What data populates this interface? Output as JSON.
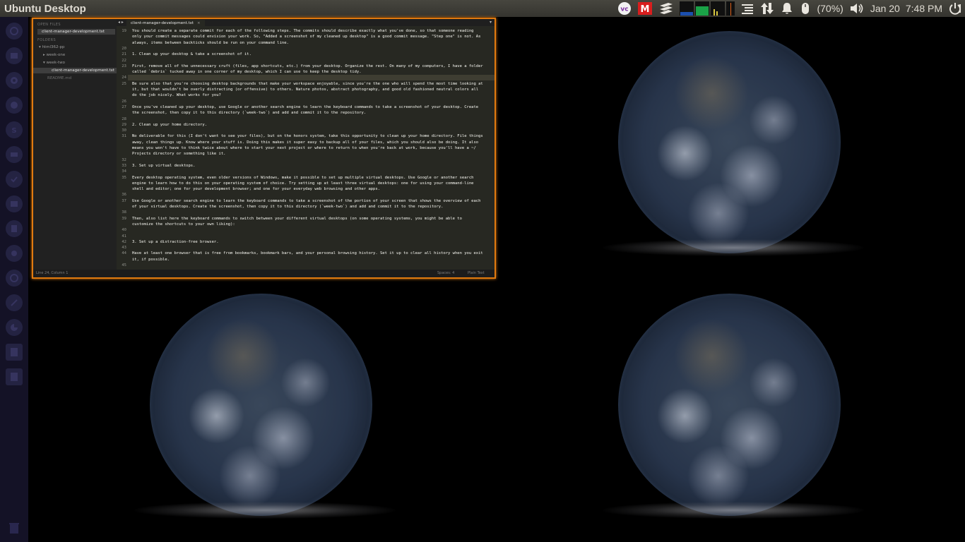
{
  "panel": {
    "title": "Ubuntu Desktop",
    "battery_text": "(70%)",
    "date": "Jan 20",
    "time": "7:48 PM"
  },
  "icons": {
    "indicators": [
      "vc-icon",
      "m-indicator-icon",
      "layers-icon",
      "system-monitor-icon",
      "menu-list-icon",
      "network-arrows-icon",
      "notification-bell-icon",
      "mouse-battery-icon",
      "volume-icon",
      "power-icon"
    ],
    "launcher": [
      "dash-icon",
      "files-icon",
      "chrome-icon",
      "firefox-icon",
      "sublime-icon",
      "skype-icon",
      "text-editor-icon",
      "terminal-icon",
      "app-icon",
      "app-icon",
      "settings-icon",
      "disk-icon",
      "disk-icon",
      "tools-icon",
      "usage-icon",
      "drive-icon",
      "drive-icon",
      "trash-icon"
    ]
  },
  "colors": {
    "window_border": "#e07a10",
    "editor_bg": "#272822",
    "launcher_bg": "#141226"
  },
  "editor": {
    "tab_label": "client-manager-development.txt",
    "sidebar": {
      "open_files_header": "OPEN FILES",
      "open_file": "client-manager-development.txt",
      "folders_header": "FOLDERS",
      "folder_root": "html362-pp",
      "folder_week_one": "week-one",
      "folder_week_two": "week-two",
      "file_selected": "client-manager-development.txt",
      "file_readme": "README.md"
    },
    "status": {
      "position": "Line 24, Column 1",
      "spaces": "Spaces: 4",
      "syntax": "Plain Text"
    },
    "lines": [
      {
        "n": "19",
        "t": "You should create a separate commit for each of the following steps. The commits should describe exactly what you've done, so that someone reading"
      },
      {
        "n": "",
        "t": "only your commit messages could envision your work. So, \"Added a screenshot of my cleaned up desktop\" is a good commit message. \"Step one\" is not. As"
      },
      {
        "n": "",
        "t": "always, items between backticks should be run on your command line."
      },
      {
        "n": "20",
        "t": ""
      },
      {
        "n": "21",
        "t": "1. Clean up your desktop & take a screenshot of it."
      },
      {
        "n": "22",
        "t": ""
      },
      {
        "n": "23",
        "t": "First, remove all of the unnecessary cruft (files, app shortcuts, etc.) from your desktop. Organize the rest. On many of my computers, I have a folder"
      },
      {
        "n": "",
        "t": "called `debris` tucked away in one corner of my desktop, which I can use to keep the desktop tidy."
      },
      {
        "n": "24",
        "t": ""
      },
      {
        "n": "25",
        "t": "Be sure also that you're choosing desktop backgrounds that make your workspace enjoyable, since you're the one who will spend the most time looking at"
      },
      {
        "n": "",
        "t": "it, but that wouldn't be overly distracting (or offensive) to others. Nature photos, abstract photography, and good old fashioned neutral colors all"
      },
      {
        "n": "",
        "t": "do the job nicely. What works for you?"
      },
      {
        "n": "26",
        "t": ""
      },
      {
        "n": "27",
        "t": "Once you've cleaned up your desktop, use Google or another search engine to learn the keyboard commands to take a screenshot of your desktop. Create"
      },
      {
        "n": "",
        "t": "the screenshot, then copy it to this directory (`week-two`) and add and commit it to the repository."
      },
      {
        "n": "28",
        "t": ""
      },
      {
        "n": "29",
        "t": "2. Clean up your home directory."
      },
      {
        "n": "30",
        "t": ""
      },
      {
        "n": "31",
        "t": "No deliverable for this (I don't want to see your files), but on the honors system, take this opportunity to clean up your home directory. File things"
      },
      {
        "n": "",
        "t": "away, clean things up. Know where your stuff is. Doing this makes it super easy to backup all of your files, which you should also be doing. It also"
      },
      {
        "n": "",
        "t": "means you won't have to think twice about where to start your next project or where to return to when you're back at work, because you'll have a ~/"
      },
      {
        "n": "",
        "t": "Projects directory or something like it."
      },
      {
        "n": "32",
        "t": ""
      },
      {
        "n": "33",
        "t": "3. Set up virtual desktops."
      },
      {
        "n": "34",
        "t": ""
      },
      {
        "n": "35",
        "t": "Every desktop operating system, even older versions of Windows, make it possible to set up multiple virtual desktops. Use Google or another search"
      },
      {
        "n": "",
        "t": "engine to learn how to do this on your operating system of choice. Try setting up at least three virtual desktops: one for using your command-line"
      },
      {
        "n": "",
        "t": "shell and editor; one for your development browser; and one for your everyday web browsing and other apps."
      },
      {
        "n": "36",
        "t": ""
      },
      {
        "n": "37",
        "t": "Use Google or another search engine to learn the keyboard commands to take a screenshot of the portion of your screen that shows the overview of each"
      },
      {
        "n": "",
        "t": "of your virtual desktops. Create the screenshot, then copy it to this directory (`week-two`) and add and commit it to the repository."
      },
      {
        "n": "38",
        "t": ""
      },
      {
        "n": "39",
        "t": "Then, also list here the keyboard commands to switch between your different virtual desktops (on some operating systems, you might be able to"
      },
      {
        "n": "",
        "t": "customize the shortcuts to your own liking):"
      },
      {
        "n": "40",
        "t": ""
      },
      {
        "n": "41",
        "t": ""
      },
      {
        "n": "42",
        "t": "3. Set up a distraction-free browser."
      },
      {
        "n": "43",
        "t": ""
      },
      {
        "n": "44",
        "t": "Have at least one browser that is free from bookmarks, bookmark bars, and your personal browsing history. Set it up to clear all history when you exit"
      },
      {
        "n": "",
        "t": "it, if possible."
      },
      {
        "n": "45",
        "t": ""
      }
    ]
  }
}
